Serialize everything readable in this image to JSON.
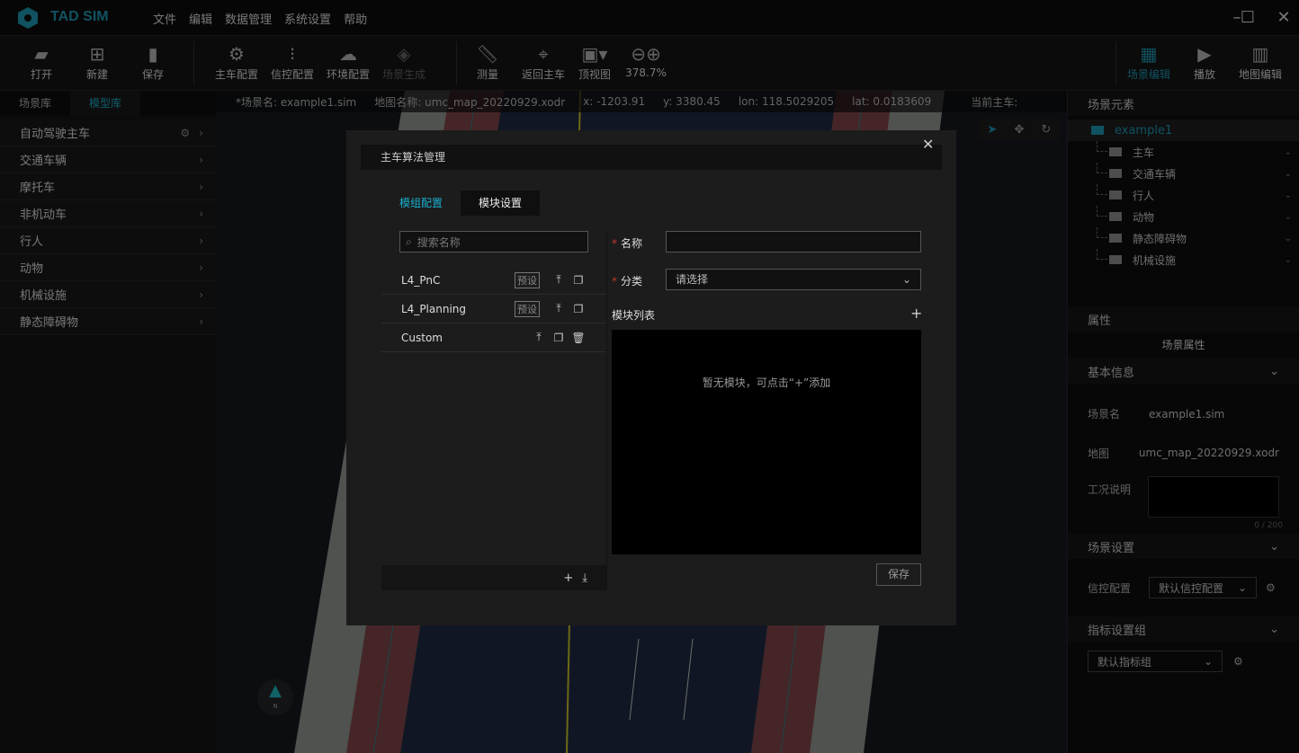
{
  "app": {
    "name": "TAD SIM",
    "menu": [
      "文件",
      "编辑",
      "数据管理",
      "系统设置",
      "帮助"
    ]
  },
  "toolbar": {
    "open": "打开",
    "new": "新建",
    "save": "保存",
    "ego_config": "主车配置",
    "signal_config": "信控配置",
    "env_config": "环境配置",
    "scene_gen": "场景生成",
    "measure": "测量",
    "return_ego": "返回主车",
    "top_view": "顶视图",
    "zoom": "378.7%",
    "scene_edit": "场景编辑",
    "play": "播放",
    "map_edit": "地图编辑"
  },
  "left": {
    "tabs": [
      "场景库",
      "模型库"
    ],
    "items": [
      "自动驾驶主车",
      "交通车辆",
      "摩托车",
      "非机动车",
      "行人",
      "动物",
      "机械设施",
      "静态障碍物"
    ]
  },
  "info": {
    "scene": "*场景名: example1.sim",
    "map": "地图名称: umc_map_20220929.xodr",
    "x": "x: -1203.91",
    "y": "y: 3380.45",
    "lon": "lon: 118.5029205",
    "lat": "lat: 0.0183609",
    "ego": "当前主车:"
  },
  "compass": "N",
  "right": {
    "elements_title": "场景元素",
    "root": "example1",
    "nodes": [
      "主车",
      "交通车辆",
      "行人",
      "动物",
      "静态障碍物",
      "机械设施"
    ],
    "props_title": "属性",
    "scene_props": "场景属性",
    "basic_info": "基本信息",
    "scene_name_label": "场景名",
    "scene_name": "example1.sim",
    "map_label": "地图",
    "map": "umc_map_20220929.xodr",
    "desc_label": "工况说明",
    "desc_count": "0 / 200",
    "scene_settings": "场景设置",
    "signal_label": "信控配置",
    "signal_value": "默认信控配置",
    "metrics_group": "指标设置组",
    "metrics_value": "默认指标组"
  },
  "modal": {
    "title": "主车算法管理",
    "tabs": [
      "模组配置",
      "模块设置"
    ],
    "search_placeholder": "搜索名称",
    "algos": [
      {
        "name": "L4_PnC",
        "tag": "预设"
      },
      {
        "name": "L4_Planning",
        "tag": "预设"
      },
      {
        "name": "Custom",
        "tag": ""
      }
    ],
    "name_label": "名称",
    "category_label": "分类",
    "category_placeholder": "请选择",
    "module_list": "模块列表",
    "empty": "暂无模块，可点击“+”添加",
    "save": "保存"
  },
  "colors": {
    "accent": "#1a7f96",
    "bg": "#0b0b0b"
  }
}
